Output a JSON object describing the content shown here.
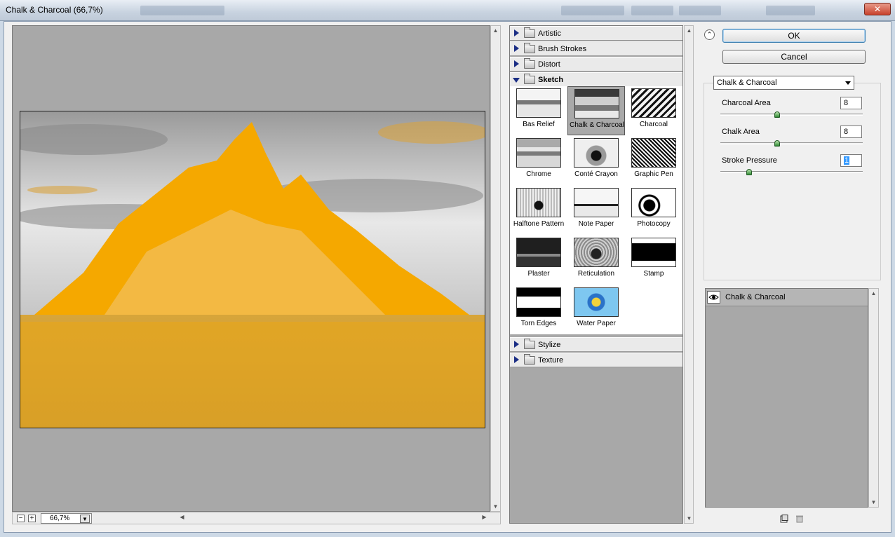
{
  "window": {
    "title": "Chalk & Charcoal (66,7%)",
    "close_glyph": "✕"
  },
  "preview": {
    "zoom_value": "66,7%",
    "zoom_out_glyph": "−",
    "zoom_in_glyph": "+"
  },
  "gallery": {
    "categories_top": [
      {
        "label": "Artistic"
      },
      {
        "label": "Brush Strokes"
      },
      {
        "label": "Distort"
      },
      {
        "label": "Sketch"
      }
    ],
    "categories_bottom": [
      {
        "label": "Stylize"
      },
      {
        "label": "Texture"
      }
    ],
    "selected_filter": "Chalk & Charcoal",
    "sketch_filters": [
      {
        "label": "Bas Relief"
      },
      {
        "label": "Chalk & Charcoal"
      },
      {
        "label": "Charcoal"
      },
      {
        "label": "Chrome"
      },
      {
        "label": "Conté Crayon"
      },
      {
        "label": "Graphic Pen"
      },
      {
        "label": "Halftone Pattern"
      },
      {
        "label": "Note Paper"
      },
      {
        "label": "Photocopy"
      },
      {
        "label": "Plaster"
      },
      {
        "label": "Reticulation"
      },
      {
        "label": "Stamp"
      },
      {
        "label": "Torn Edges"
      },
      {
        "label": "Water Paper"
      }
    ]
  },
  "buttons": {
    "ok": "OK",
    "cancel": "Cancel",
    "collapse_glyph": "⌃"
  },
  "settings": {
    "filter_select": "Chalk & Charcoal",
    "params": [
      {
        "label": "Charcoal Area",
        "value": "8",
        "level": 0.4
      },
      {
        "label": "Chalk Area",
        "value": "8",
        "level": 0.4
      },
      {
        "label": "Stroke Pressure",
        "value": "1",
        "level": 0.2
      }
    ]
  },
  "layers": {
    "items": [
      {
        "label": "Chalk & Charcoal",
        "visible": true
      }
    ]
  },
  "colors": {
    "accent": "#1b2e85",
    "preview_orange": "#f5a800",
    "canvas_gray": "#a8a8a8"
  }
}
